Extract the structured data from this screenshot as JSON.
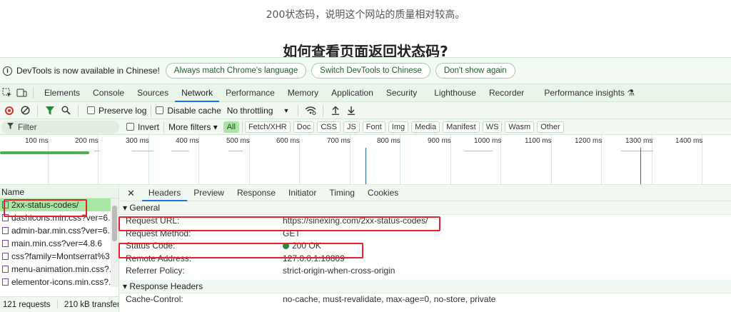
{
  "article": {
    "line": "200状态码，说明这个网站的质量相对较高。",
    "heading": "如何查看页面返回状态码?"
  },
  "infobar": {
    "message": "DevTools is now available in Chinese!",
    "buttons": [
      "Always match Chrome's language",
      "Switch DevTools to Chinese",
      "Don't show again"
    ]
  },
  "tabs": [
    "Elements",
    "Console",
    "Sources",
    "Network",
    "Performance",
    "Memory",
    "Application",
    "Security",
    "Lighthouse",
    "Recorder",
    "Performance insights ⚗"
  ],
  "active_tab": "Network",
  "toolbar": {
    "preserve_log": "Preserve log",
    "disable_cache": "Disable cache",
    "throttling": "No throttling"
  },
  "filterbar": {
    "placeholder": "Filter",
    "invert": "Invert",
    "more_filters": "More filters ▾",
    "types": [
      "All",
      "Fetch/XHR",
      "Doc",
      "CSS",
      "JS",
      "Font",
      "Img",
      "Media",
      "Manifest",
      "WS",
      "Wasm",
      "Other"
    ],
    "active_type": "All"
  },
  "timeline": {
    "labels": [
      "100 ms",
      "200 ms",
      "300 ms",
      "400 ms",
      "500 ms",
      "600 ms",
      "700 ms",
      "800 ms",
      "900 ms",
      "1000 ms",
      "1100 ms",
      "1200 ms",
      "1300 ms",
      "1400 ms"
    ]
  },
  "requests": {
    "header": "Name",
    "items": [
      {
        "name": "2xx-status-codes/",
        "type": "doc",
        "selected": true
      },
      {
        "name": "dashicons.min.css?ver=6....",
        "type": "css"
      },
      {
        "name": "admin-bar.min.css?ver=6....",
        "type": "css"
      },
      {
        "name": "main.min.css?ver=4.8.6",
        "type": "css"
      },
      {
        "name": "css?family=Montserrat%3...",
        "type": "css"
      },
      {
        "name": "menu-animation.min.css?...",
        "type": "css"
      },
      {
        "name": "elementor-icons.min.css?...",
        "type": "css"
      }
    ],
    "footer_count": "121 requests",
    "footer_size": "210 kB transferre"
  },
  "details": {
    "tabs": [
      "Headers",
      "Preview",
      "Response",
      "Initiator",
      "Timing",
      "Cookies"
    ],
    "active_tab": "Headers",
    "general_title": "▾ General",
    "general": [
      {
        "key": "Request URL:",
        "value": "https://sinexing.com/2xx-status-codes/"
      },
      {
        "key": "Request Method:",
        "value": "GET"
      },
      {
        "key": "Status Code:",
        "value": "200 OK"
      },
      {
        "key": "Remote Address:",
        "value": "127.0.0.1:10809"
      },
      {
        "key": "Referrer Policy:",
        "value": "strict-origin-when-cross-origin"
      }
    ],
    "response_title": "▾ Response Headers",
    "partial_row": {
      "key": "Cache-Control:",
      "value": "no-cache, must-revalidate, max-age=0, no-store, private"
    }
  },
  "colors": {
    "status_ok": "#1e8e3e",
    "highlight": "#e8202a",
    "selected_row": "#a8e6a3",
    "accent": "#1a73e8"
  }
}
